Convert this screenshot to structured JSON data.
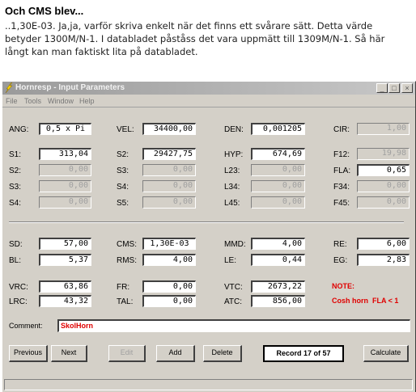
{
  "post": {
    "title": "Och CMS blev...",
    "body": "..1,30E-03. Ja,ja, varför skriva enkelt när det finns ett svårare sätt. Detta värde betyder 1300M/N-1. I databladet påståss det vara uppmätt till 1309M/N-1. Så här långt kan man faktiskt lita på databladet."
  },
  "window": {
    "title": "Hornresp - Input Parameters",
    "controls": {
      "minimize": "_",
      "maximize": "□",
      "close": "×"
    }
  },
  "menu": [
    "File",
    "Tools",
    "Window",
    "Help"
  ],
  "params": {
    "ang": {
      "label": "ANG:",
      "value": "0,5 x Pi"
    },
    "vel": {
      "label": "VEL:",
      "value": "34400,00"
    },
    "den": {
      "label": "DEN:",
      "value": "0,001205"
    },
    "cir": {
      "label": "CIR:",
      "value": "1,00"
    },
    "s1": {
      "label": "S1:",
      "value": "313,04"
    },
    "s2": {
      "label": "S2:",
      "value": "29427,75"
    },
    "hyp": {
      "label": "HYP:",
      "value": "674,69"
    },
    "f12": {
      "label": "F12:",
      "value": "19,98"
    },
    "s2b": {
      "label": "S2:",
      "value": "0,00"
    },
    "s3": {
      "label": "S3:",
      "value": "0,00"
    },
    "l23": {
      "label": "L23:",
      "value": "0,00"
    },
    "fla": {
      "label": "FLA:",
      "value": "0,65"
    },
    "s3b": {
      "label": "S3:",
      "value": "0,00"
    },
    "s4": {
      "label": "S4:",
      "value": "0,00"
    },
    "l34": {
      "label": "L34:",
      "value": "0,00"
    },
    "f34": {
      "label": "F34:",
      "value": "0,00"
    },
    "s4b": {
      "label": "S4:",
      "value": "0,00"
    },
    "s5": {
      "label": "S5:",
      "value": "0,00"
    },
    "l45": {
      "label": "L45:",
      "value": "0,00"
    },
    "f45": {
      "label": "F45:",
      "value": "0,00"
    },
    "sd": {
      "label": "SD:",
      "value": "57,00"
    },
    "cms": {
      "label": "CMS:",
      "value": "1,30E-03"
    },
    "mmd": {
      "label": "MMD:",
      "value": "4,00"
    },
    "re": {
      "label": "RE:",
      "value": "6,00"
    },
    "bl": {
      "label": "BL:",
      "value": "5,37"
    },
    "rms": {
      "label": "RMS:",
      "value": "4,00"
    },
    "le": {
      "label": "LE:",
      "value": "0,44"
    },
    "eg": {
      "label": "EG:",
      "value": "2,83"
    },
    "vrc": {
      "label": "VRC:",
      "value": "63,86"
    },
    "fr": {
      "label": "FR:",
      "value": "0,00"
    },
    "vtc": {
      "label": "VTC:",
      "value": "2673,22"
    },
    "lrc": {
      "label": "LRC:",
      "value": "43,32"
    },
    "tal": {
      "label": "TAL:",
      "value": "0,00"
    },
    "atc": {
      "label": "ATC:",
      "value": "856,00"
    }
  },
  "note": {
    "label": "NOTE:",
    "text": "Cosh horn  FLA < 1"
  },
  "comment": {
    "label": "Comment:",
    "value": "SkolHorn"
  },
  "buttons": {
    "previous": "Previous",
    "next": "Next",
    "edit": "Edit",
    "add": "Add",
    "delete": "Delete",
    "calculate": "Calculate"
  },
  "record": "Record 17 of 57",
  "colors": {
    "note": "#e00000",
    "window_bg": "#d4d0c8",
    "titlebar": "#9a9a9a"
  }
}
